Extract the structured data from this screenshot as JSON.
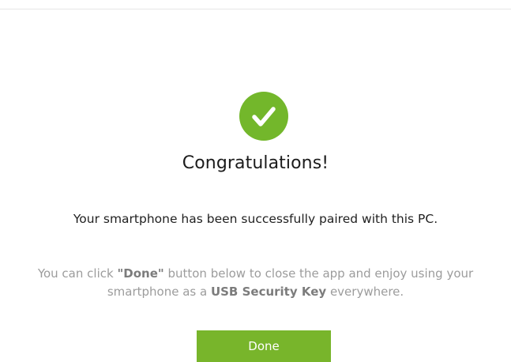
{
  "colors": {
    "accent": "#78b52b",
    "check_badge": "#73b72b",
    "title_text": "#1b1b1b",
    "hint_text": "#9c9c9c"
  },
  "status_icon": "checkmark-circle-icon",
  "title": "Congratulations!",
  "message": "Your smartphone has been successfully paired with this PC.",
  "hint": {
    "part1": "You can click ",
    "done_ref": "\"Done\"",
    "part2": " button below to close the app and enjoy using your smartphone as a ",
    "key_ref": "USB Security Key",
    "part3": " everywhere."
  },
  "done_button": {
    "label": "Done"
  }
}
